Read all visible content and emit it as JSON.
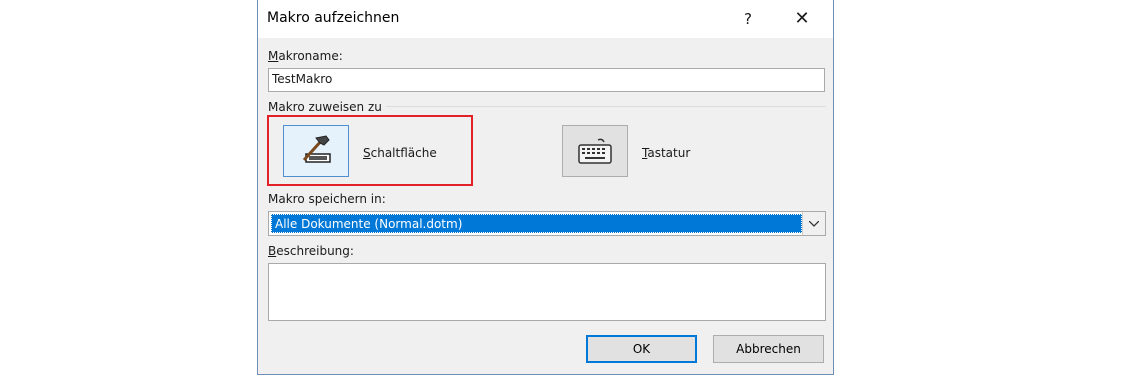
{
  "dialog": {
    "title": "Makro aufzeichnen",
    "help_label": "?",
    "close_label": "✕"
  },
  "macro_name": {
    "label": "Makroname:",
    "value": "TestMakro"
  },
  "assign": {
    "group_label": "Makro zuweisen zu",
    "button_label": "Schaltfläche",
    "keyboard_label": "Tastatur",
    "button_icon": "hammer-icon",
    "keyboard_icon": "keyboard-icon",
    "highlight_color": "#e32027"
  },
  "store_in": {
    "label": "Makro speichern in:",
    "selected": "Alle Dokumente (Normal.dotm)"
  },
  "description": {
    "label": "Beschreibung:",
    "value": ""
  },
  "buttons": {
    "ok": "OK",
    "cancel": "Abbrechen"
  },
  "colors": {
    "accent": "#0078d7",
    "dialog_bg": "#f0f0f0"
  }
}
